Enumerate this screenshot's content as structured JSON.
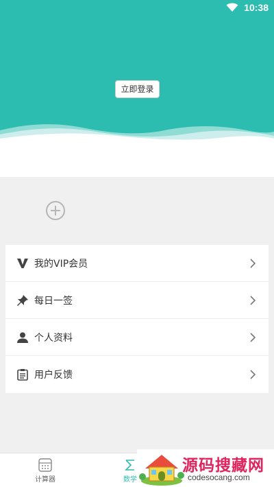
{
  "status_bar": {
    "time": "10:38",
    "wifi_icon": "wifi-icon"
  },
  "header": {
    "login_button": "立即登录",
    "bg_color": "#2cbcb0"
  },
  "add_icon": "plus-circle-icon",
  "menu": {
    "items": [
      {
        "icon": "vip-v-icon",
        "label": "我的VIP会员"
      },
      {
        "icon": "pin-icon",
        "label": "每日一签"
      },
      {
        "icon": "person-icon",
        "label": "个人资料"
      },
      {
        "icon": "clipboard-icon",
        "label": "用户反馈"
      }
    ]
  },
  "tabbar": {
    "tabs": [
      {
        "icon": "calculator-icon",
        "label": "计算器"
      },
      {
        "icon": "math-icon",
        "label": "数学"
      }
    ],
    "accent": "#2cbcb0"
  },
  "watermark": {
    "title": "源码搜藏网",
    "subtitle": "codesocang.com"
  }
}
